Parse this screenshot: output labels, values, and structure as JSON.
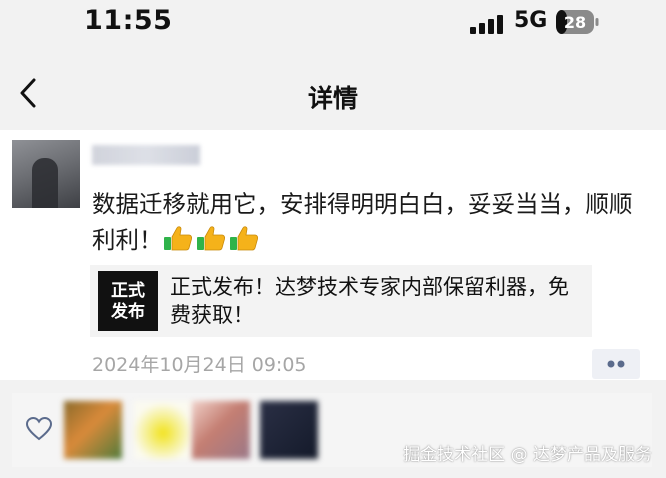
{
  "status_bar": {
    "time": "11:55",
    "network": "5G",
    "battery_level": "28"
  },
  "nav": {
    "title": "详情"
  },
  "post": {
    "text": "数据迁移就用它，安排得明明白白，妥妥当当，顺顺利利！",
    "thumbs_up_count": 3,
    "link_card": {
      "thumb_text_line1": "正式",
      "thumb_text_line2": "发布",
      "title": "正式发布！达梦技术专家内部保留利器，免费获取！"
    },
    "timestamp": "2024年10月24日 09:05"
  },
  "likes": {
    "liker_count": 4
  },
  "watermark": "掘金技术社区 @ 达梦产品及服务",
  "colors": {
    "timestamp_gray": "#a6a6a6",
    "thumb_yellow": "#f5b21a",
    "thumb_green": "#2fb34a"
  }
}
